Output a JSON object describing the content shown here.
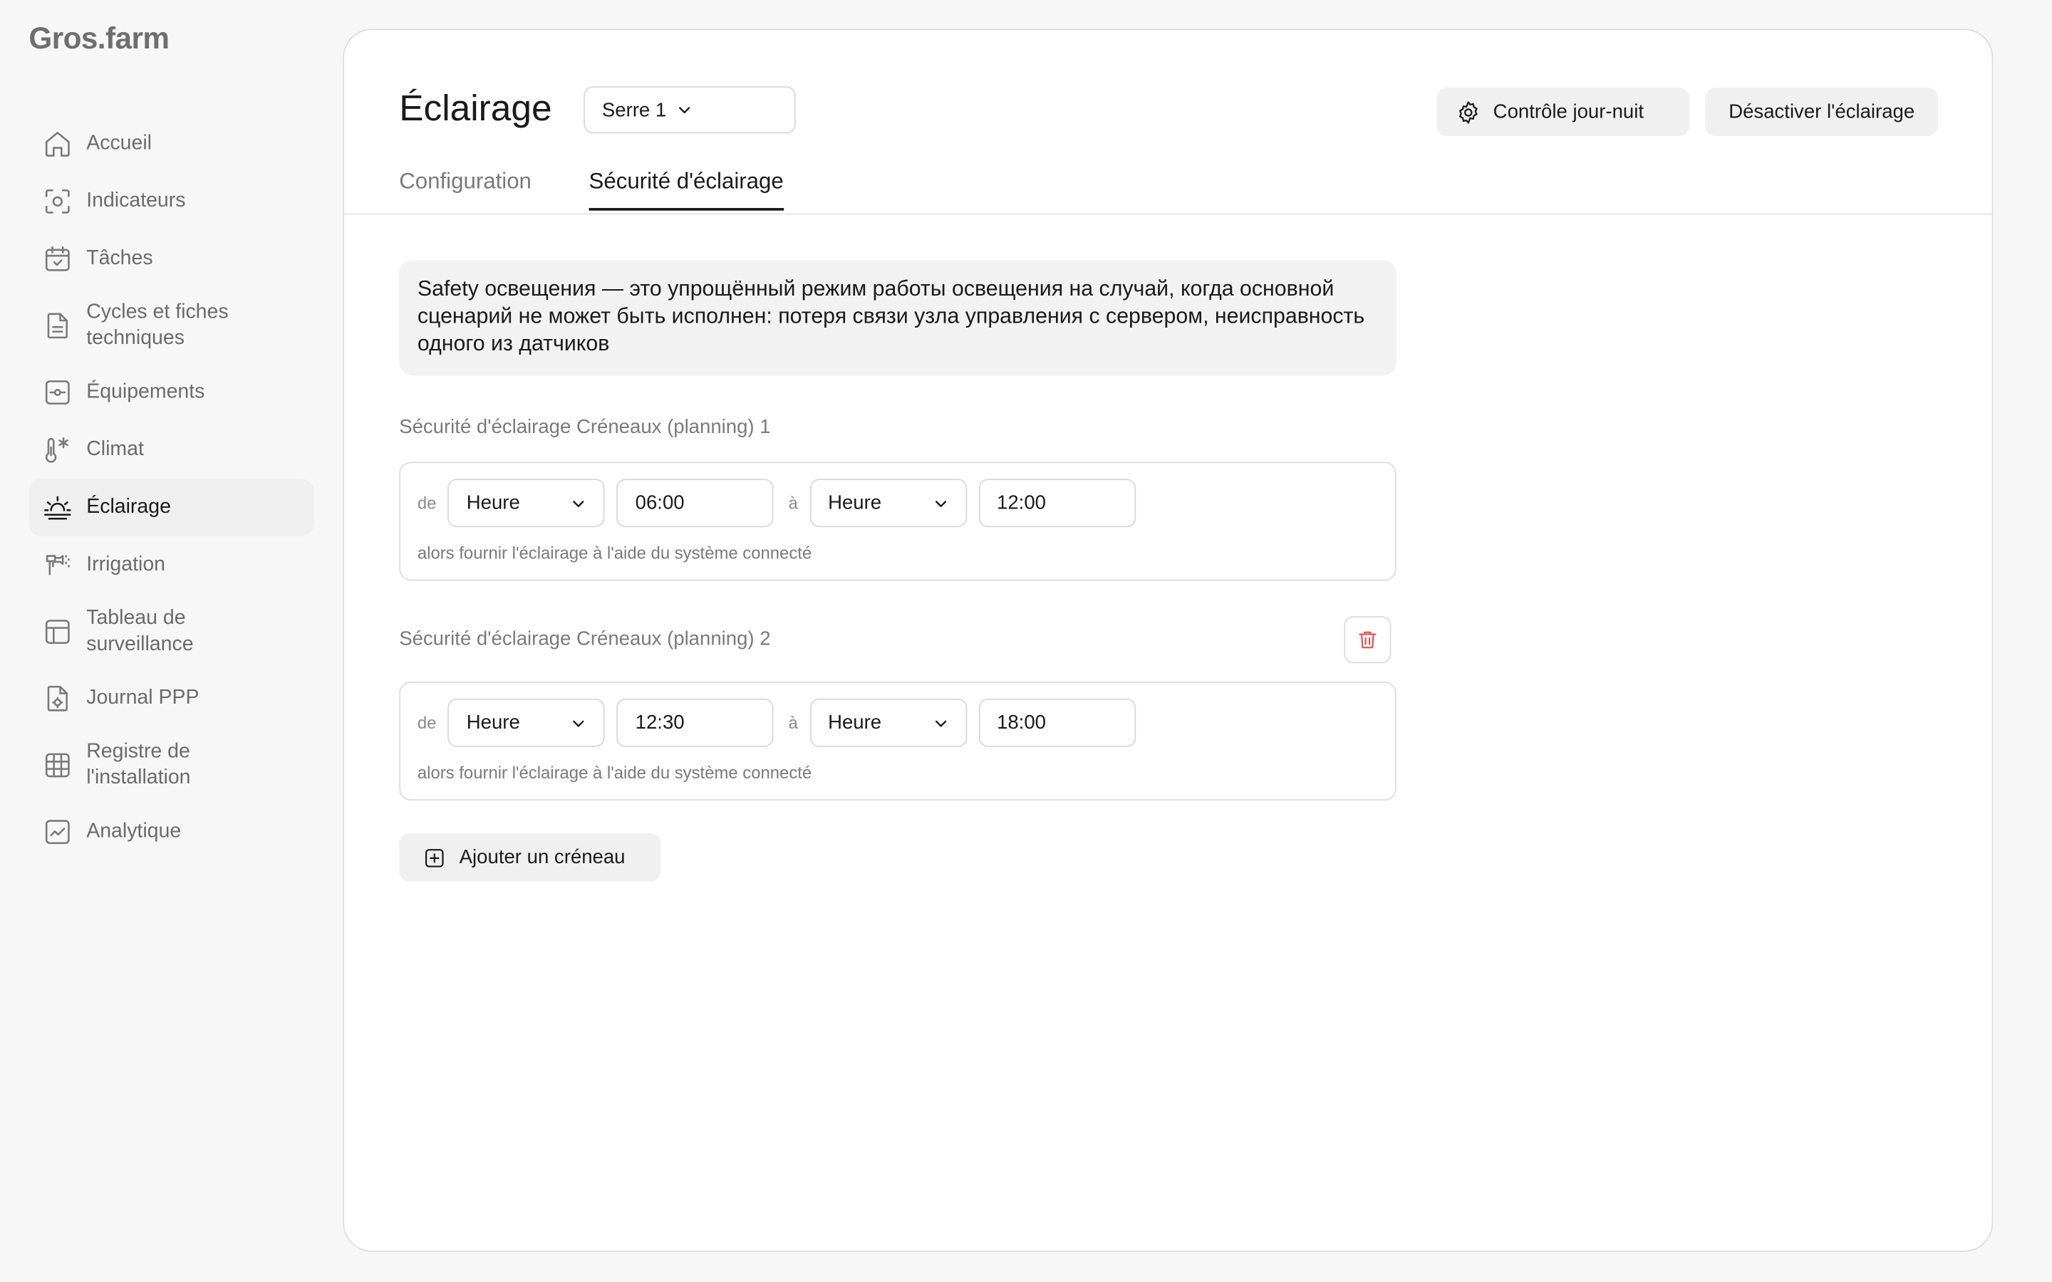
{
  "brand": "Gros.farm",
  "sidebar": {
    "items": [
      {
        "label": "Accueil",
        "icon": "home-icon"
      },
      {
        "label": "Indicateurs",
        "icon": "indicators-icon"
      },
      {
        "label": "Tâches",
        "icon": "calendar-check-icon"
      },
      {
        "label": "Cycles et fiches techniques",
        "icon": "document-icon"
      },
      {
        "label": "Équipements",
        "icon": "equipment-icon"
      },
      {
        "label": "Climat",
        "icon": "thermometer-snow-icon"
      },
      {
        "label": "Éclairage",
        "icon": "sunrise-icon",
        "active": true
      },
      {
        "label": "Irrigation",
        "icon": "irrigation-icon"
      },
      {
        "label": "Tableau de surveillance",
        "icon": "dashboard-grid-icon"
      },
      {
        "label": "Journal PPP",
        "icon": "journal-icon"
      },
      {
        "label": "Registre de l'installation",
        "icon": "grid-icon"
      },
      {
        "label": "Analytique",
        "icon": "analytics-icon"
      }
    ]
  },
  "header": {
    "title": "Éclairage",
    "greenhouse_selected": "Serre 1",
    "daynight_label": "Contrôle jour-nuit",
    "disable_label": "Désactiver l'éclairage"
  },
  "tabs": {
    "configuration": "Configuration",
    "safety": "Sécurité d'éclairage",
    "active": "safety"
  },
  "info_text": "Safety освещения — это упрощённый режим работы освещения на случай, когда основной сценарий не может быть исполнен: потеря связи узла управления с сервером,  неисправность одного из датчиков",
  "slots": [
    {
      "title": "Sécurité d'éclairage Créneaux (planning) 1",
      "from_label": "de",
      "from_unit": "Heure",
      "from_time": "06:00",
      "to_label": "à",
      "to_unit": "Heure",
      "to_time": "12:00",
      "note": "alors fournir l'éclairage à l'aide du système connecté"
    },
    {
      "title": "Sécurité d'éclairage Créneaux (planning) 2",
      "from_label": "de",
      "from_unit": "Heure",
      "from_time": "12:30",
      "to_label": "à",
      "to_unit": "Heure",
      "to_time": "18:00",
      "note": "alors fournir l'éclairage à l'aide du système connecté"
    }
  ],
  "add_slot_label": "Ajouter un créneau",
  "colors": {
    "accent": "#1a1a1a",
    "delete": "#e05252",
    "active_nav_bg": "#efefef"
  }
}
